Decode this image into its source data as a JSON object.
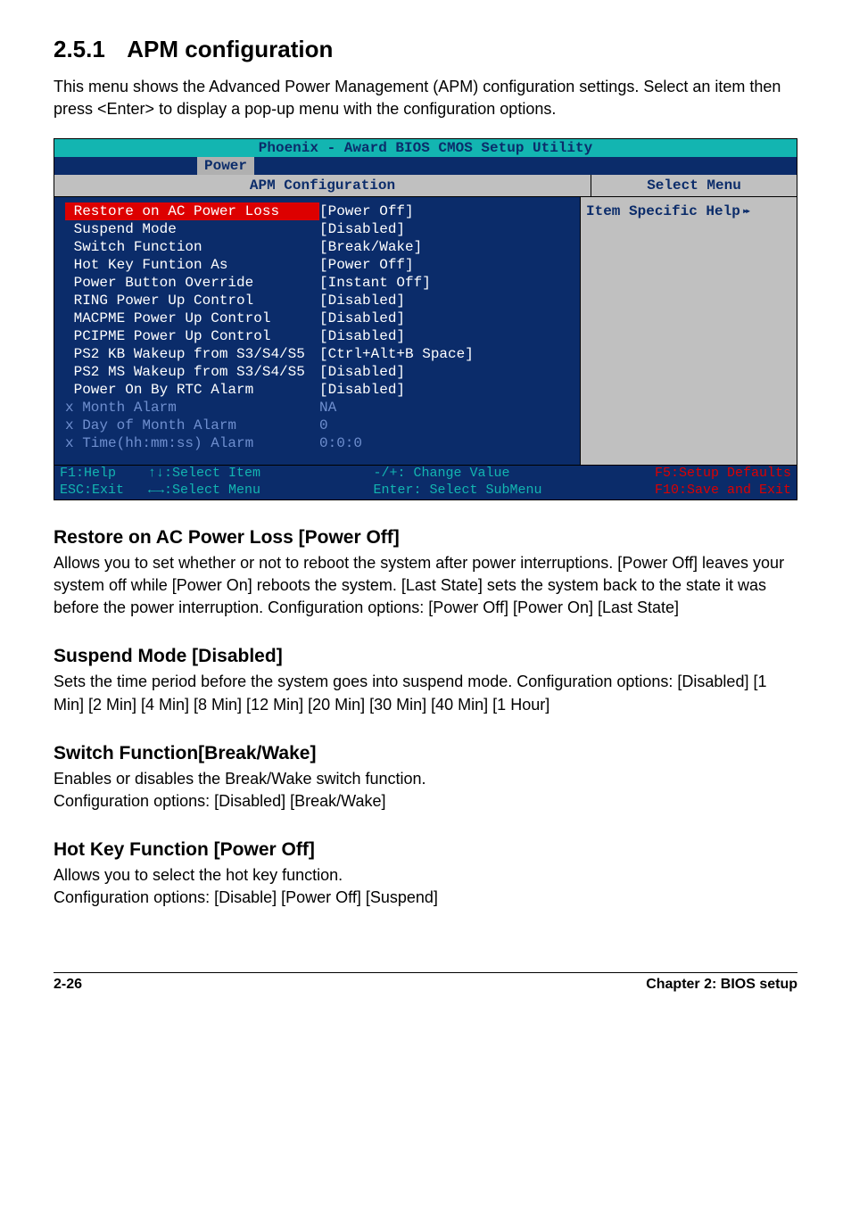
{
  "section": {
    "num": "2.5.1",
    "title": "APM configuration"
  },
  "intro": "This menu shows the Advanced Power Management (APM) configuration settings. Select an item then press <Enter> to display a pop-up menu with the configuration options.",
  "bios": {
    "titlebar": "Phoenix - Award BIOS CMOS Setup Utility",
    "tab": "Power",
    "header_left": "APM Configuration",
    "header_right": "Select Menu",
    "side_help": "Item Specific Help",
    "rows": [
      {
        "label": " Restore on AC Power Loss",
        "val": "[Power Off]",
        "sel": true
      },
      {
        "label": " Suspend Mode",
        "val": "[Disabled]"
      },
      {
        "label": " Switch Function",
        "val": "[Break/Wake]"
      },
      {
        "label": " Hot Key Funtion As",
        "val": "[Power Off]"
      },
      {
        "label": " Power Button Override",
        "val": "[Instant Off]"
      },
      {
        "label": " RING Power Up Control",
        "val": "[Disabled]"
      },
      {
        "label": " MACPME Power Up Control",
        "val": "[Disabled]"
      },
      {
        "label": " PCIPME Power Up Control",
        "val": "[Disabled]"
      },
      {
        "label": " PS2 KB Wakeup from S3/S4/S5",
        "val": "[Ctrl+Alt+B Space]"
      },
      {
        "label": " PS2 MS Wakeup from S3/S4/S5",
        "val": "[Disabled]"
      },
      {
        "label": " Power On By RTC Alarm",
        "val": "[Disabled]"
      },
      {
        "label": "x Month Alarm",
        "val": "NA",
        "dim": true
      },
      {
        "label": "x Day of Month Alarm",
        "val": "0",
        "dim": true
      },
      {
        "label": "x Time(hh:mm:ss) Alarm",
        "val": "0:0:0",
        "dim": true
      }
    ],
    "footer_left1": "F1:Help    ↑↓:Select Item",
    "footer_left2": "ESC:Exit   ←→:Select Menu",
    "footer_mid1": "-/+: Change Value",
    "footer_mid2": "Enter: Select SubMenu",
    "footer_right1": "F5:Setup Defaults",
    "footer_right2": "F10:Save and Exit"
  },
  "items": [
    {
      "heading": "Restore on AC Power Loss [Power Off]",
      "body": "Allows you to set whether or not to reboot the system after power interruptions. [Power Off] leaves your system off while [Power On] reboots the system. [Last State] sets the system back to the state it was before the power interruption. Configuration options: [Power Off] [Power On] [Last State]"
    },
    {
      "heading": "Suspend Mode [Disabled]",
      "body": "Sets the time period before the system goes into suspend mode. Configuration options: [Disabled] [1 Min] [2 Min] [4 Min] [8 Min] [12 Min] [20 Min] [30 Min] [40 Min] [1 Hour]"
    },
    {
      "heading": "Switch Function[Break/Wake]",
      "body": "Enables or disables the Break/Wake switch function.\nConfiguration options: [Disabled] [Break/Wake]"
    },
    {
      "heading": "Hot Key Function [Power Off]",
      "body": "Allows you to select the hot key function.\nConfiguration options: [Disable] [Power Off] [Suspend]"
    }
  ],
  "footer": {
    "left": "2-26",
    "right": "Chapter 2: BIOS setup"
  }
}
